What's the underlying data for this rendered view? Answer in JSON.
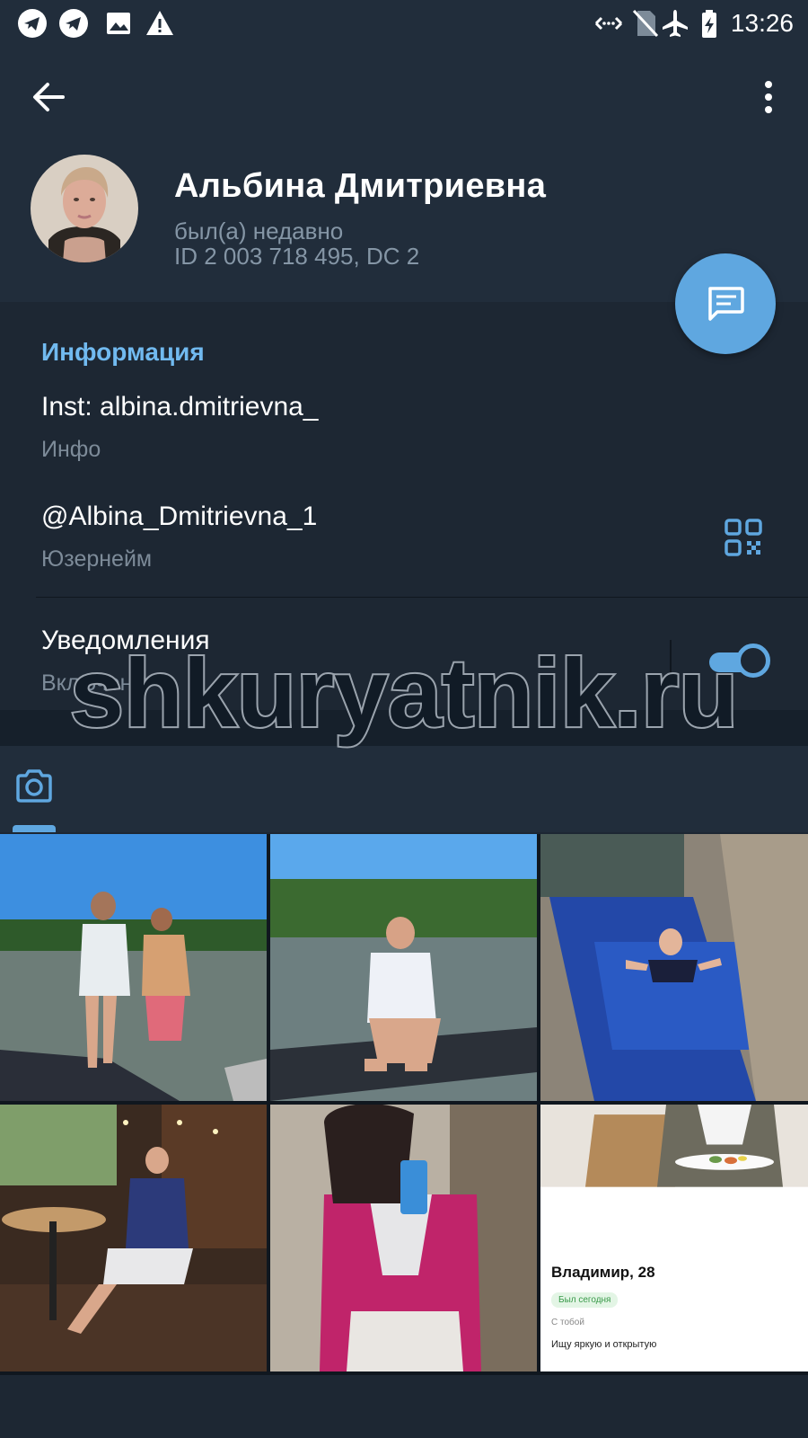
{
  "status_bar": {
    "time": "13:26",
    "left_icons": [
      "telegram-notification-icon",
      "telegram-notification-icon",
      "image-notification-icon",
      "warning-icon"
    ],
    "right_icons": [
      "data-saver-icon",
      "no-sim-icon",
      "airplane-mode-icon",
      "battery-charging-icon"
    ]
  },
  "header": {
    "back_icon": "arrow-left-icon",
    "menu_icon": "more-vertical-icon",
    "name": "Альбина Дмитриевна",
    "last_seen": "был(а) недавно",
    "id_line": "ID 2 003 718 495, DC 2"
  },
  "fab": {
    "icon": "message-icon"
  },
  "info": {
    "section_title": "Информация",
    "bio_value": "Inst: albina.dmitrievna_",
    "bio_label": "Инфо",
    "username_value": "@Albina_Dmitrievna_1",
    "username_label": "Юзернейм",
    "notifications_label": "Уведомления",
    "notifications_state": "Включены",
    "notifications_on": true
  },
  "watermark": {
    "text": "shkuryatnik.ru"
  },
  "media": {
    "tab_icon": "camera-icon",
    "last_tile": {
      "name": "Владимир, 28",
      "badge": "Был сегодня",
      "sub": "С тобой",
      "desc": "Ищу яркую и открытую"
    }
  },
  "colors": {
    "background": "#1d2733",
    "header": "#212d3b",
    "accent": "#5fa7e0",
    "section_title": "#71baf0",
    "secondary_text": "#7d8b99"
  }
}
